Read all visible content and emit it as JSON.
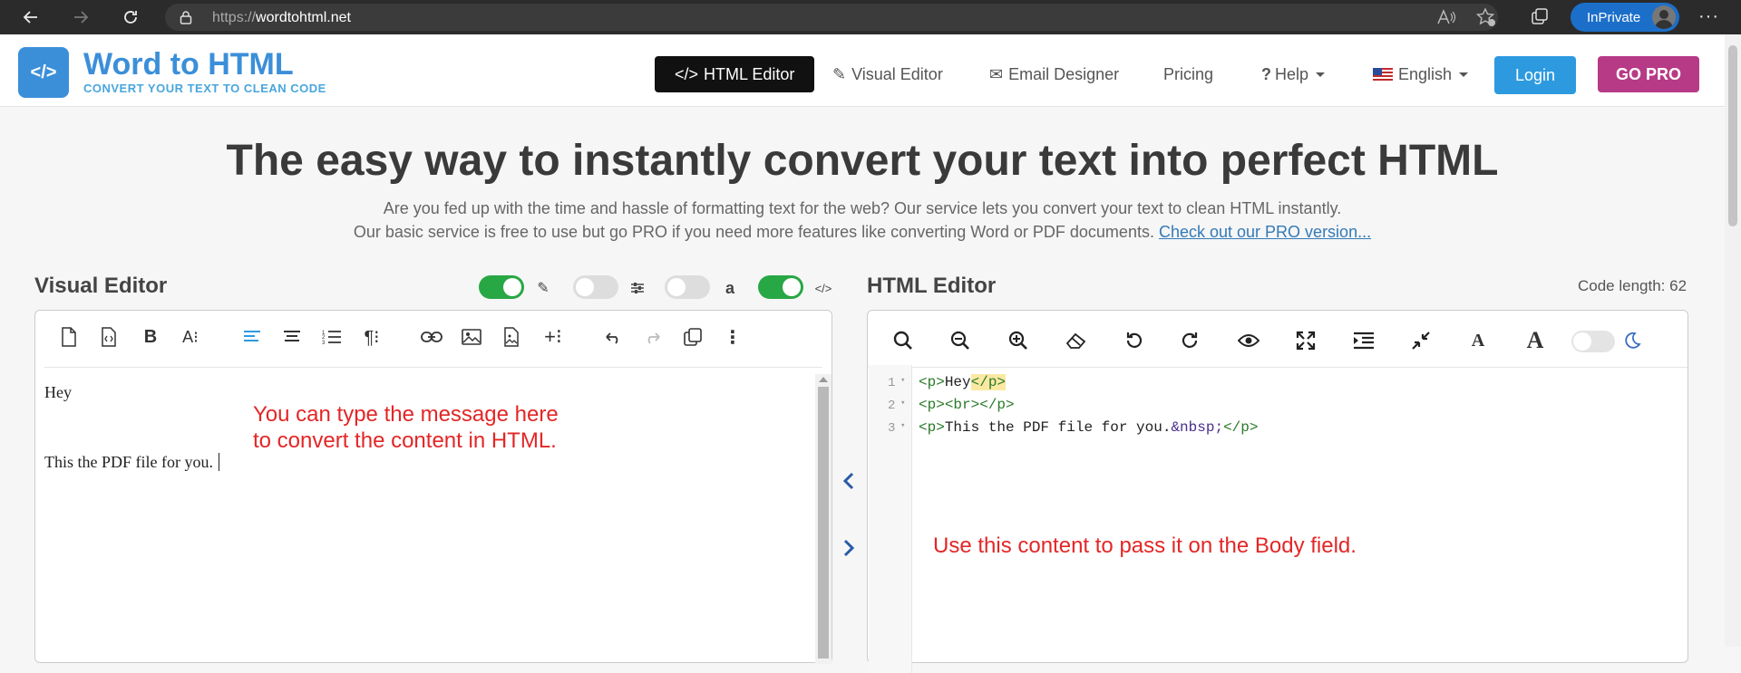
{
  "browser": {
    "url_prefix": "https://",
    "url_host": "wordtohtml.net",
    "inprivate_label": "InPrivate"
  },
  "site": {
    "logo_title": "Word to HTML",
    "logo_subtitle": "CONVERT YOUR TEXT TO CLEAN CODE",
    "nav": {
      "html_editor": "HTML Editor",
      "visual_editor": "Visual Editor",
      "email_designer": "Email Designer",
      "pricing": "Pricing",
      "help": "Help",
      "language": "English"
    },
    "login": "Login",
    "go_pro": "GO PRO"
  },
  "hero": {
    "title": "The easy way to instantly convert your text into perfect HTML",
    "line1": "Are you fed up with the time and hassle of formatting text for the web? Our service lets you convert your text to clean HTML instantly.",
    "line2": "Our basic service is free to use but go PRO if you need more features like converting Word or PDF documents.",
    "link": "Check out our PRO version..."
  },
  "visual_editor": {
    "title": "Visual Editor",
    "toggles": [
      {
        "icon": "edit-icon",
        "on": true
      },
      {
        "icon": "sliders-icon",
        "on": false
      },
      {
        "icon": "amazon-icon",
        "on": false
      },
      {
        "icon": "code-icon",
        "on": true
      }
    ],
    "content_line1": "Hey",
    "content_line2": "This the PDF file for you."
  },
  "html_editor": {
    "title": "HTML Editor",
    "code_length": "Code length: 62",
    "line_numbers": [
      "1",
      "2",
      "3"
    ],
    "lines": [
      {
        "open": "<p>",
        "text": "Hey",
        "close": "</p>"
      },
      {
        "open": "<p>",
        "text": "<br>",
        "close": "</p>"
      },
      {
        "open": "<p>",
        "text": "This the PDF file for you.",
        "entity": "&nbsp;",
        "close": "</p>"
      }
    ],
    "dark_mode_on": false
  },
  "annotations": {
    "left_line1": "You can type the message here",
    "left_line2": "to convert the content in HTML.",
    "right": "Use this content to pass it on the Body field."
  },
  "colors": {
    "brand_blue": "#3b8fd9",
    "login_blue": "#2d9ae0",
    "pro_magenta": "#b73a86",
    "toggle_green": "#28a745",
    "annotation_red": "#e32626"
  }
}
